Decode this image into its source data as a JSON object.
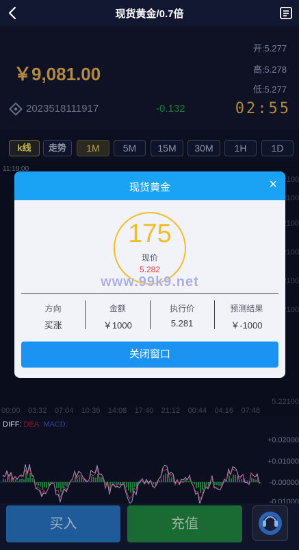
{
  "header": {
    "title": "现货黄金/0.7倍"
  },
  "quote": {
    "balance": "￥9,081.00",
    "open_label": "开:",
    "open_value": "5.277",
    "high_label": "高:",
    "high_value": "5.278",
    "low_label": "低:",
    "low_value": "5.277",
    "order_id": "2023518111917",
    "change": "-0.132",
    "countdown": "02:55"
  },
  "chart_types": [
    "k线",
    "走势"
  ],
  "periods": [
    "1M",
    "5M",
    "15M",
    "30M",
    "1H",
    "1D"
  ],
  "active_period": "1M",
  "chart": {
    "time_label": "11:19:00",
    "axis_top": "5.2100",
    "axis_right_labels": [
      "5.2100",
      "5.2100",
      "5.2100",
      "5.2100",
      "5.2100",
      "5.2100"
    ],
    "axis_bottom": "5.22100",
    "time_axis": [
      "00:00",
      "03:32",
      "07:04",
      "10:36",
      "14:08",
      "17:40",
      "21:12",
      "00:44",
      "04:16",
      "07:48"
    ],
    "diff_label": "DIFF:",
    "dea_label": "DEA:",
    "macd_label": "MACD:",
    "macd_axis": [
      "+0.02000",
      "+0.01000",
      "-0.00000",
      "-0.01000"
    ]
  },
  "modal": {
    "title": "现货黄金",
    "close_icon": "×",
    "countdown_value": "175",
    "price_label": "现价",
    "price_value": "5.282",
    "watermark": "www.99k9.net",
    "stats": [
      {
        "label": "方向",
        "value": "买涨"
      },
      {
        "label": "金额",
        "value": "￥1000"
      },
      {
        "label": "执行价",
        "value": "5.281"
      },
      {
        "label": "预测结果",
        "value": "￥-1000"
      }
    ],
    "close_button": "关闭窗口",
    "ring_color": "#f0bd2a"
  },
  "bottom": {
    "buy_label": "买入",
    "recharge_label": "充值"
  },
  "colors": {
    "gold": "#b48a3e",
    "green": "#1e7a3a",
    "blue": "#1aa3f4"
  }
}
